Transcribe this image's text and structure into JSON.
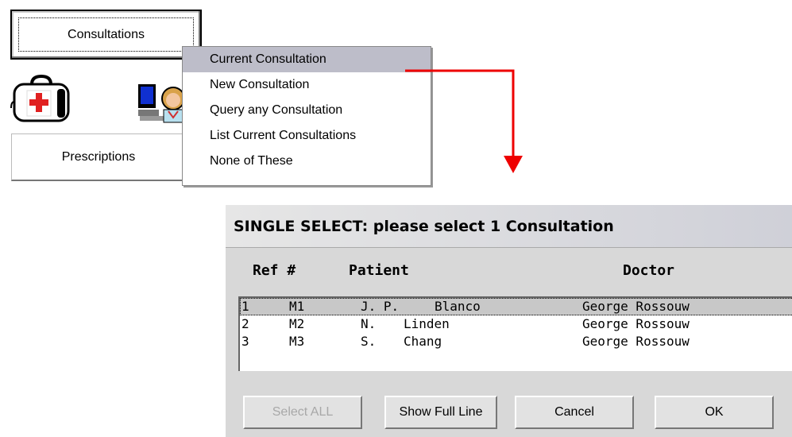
{
  "toolbar": {
    "consultations_label": "Consultations",
    "prescriptions_label": "Prescriptions"
  },
  "icons": [
    "medical-bag-icon",
    "doctor-computer-icon"
  ],
  "menu": {
    "items": [
      "Current Consultation",
      "New Consultation",
      "Query any Consultation",
      "List Current Consultations",
      "None of These"
    ],
    "selected_index": 0
  },
  "dialog": {
    "title": "SINGLE SELECT: please select 1 Consultation",
    "columns": {
      "ref": "Ref #",
      "patient": "Patient",
      "doctor": "Doctor"
    },
    "rows": [
      {
        "num": "1",
        "ref": "M1",
        "initials": "J. P.",
        "surname": "Blanco",
        "doctor": "George Rossouw"
      },
      {
        "num": "2",
        "ref": "M2",
        "initials": "N.",
        "surname": "Linden",
        "doctor": "George Rossouw"
      },
      {
        "num": "3",
        "ref": "M3",
        "initials": "S.",
        "surname": "Chang",
        "doctor": "George Rossouw"
      }
    ],
    "selected_row": 0,
    "buttons": {
      "select_all": "Select ALL",
      "show_full_line": "Show Full Line",
      "cancel": "Cancel",
      "ok": "OK"
    }
  },
  "colors": {
    "arrow": "#ee0000",
    "menu_highlight": "#bdbdc9",
    "row_highlight": "#c8c8c8"
  }
}
